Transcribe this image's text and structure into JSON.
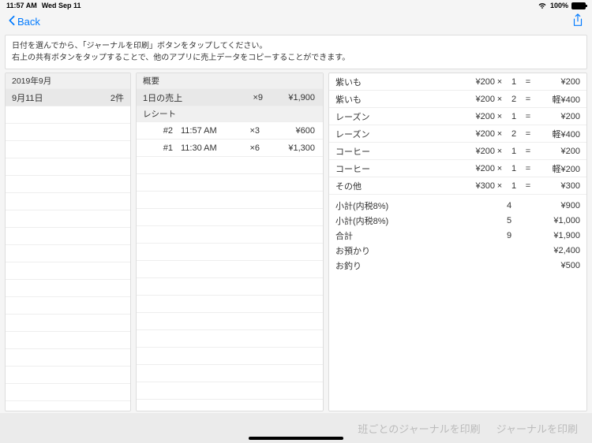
{
  "status": {
    "time": "11:57 AM",
    "date": "Wed Sep 11",
    "battery": "100%"
  },
  "nav": {
    "back": "Back"
  },
  "instructions": {
    "line1": "日付を選んでから、「ジャーナルを印刷」ボタンをタップしてください。",
    "line2": "右上の共有ボタンをタップすることで、他のアプリに売上データをコピーすることができます。"
  },
  "dates": {
    "header": "2019年9月",
    "items": [
      {
        "date": "9月11日",
        "count": "2件"
      }
    ]
  },
  "summary": {
    "header": "概要",
    "daily": {
      "label": "1日の売上",
      "qty": "×9",
      "amount": "¥1,900"
    },
    "receipts_header": "レシート",
    "receipts": [
      {
        "num": "#2",
        "time": "11:57 AM",
        "qty": "×3",
        "amount": "¥600"
      },
      {
        "num": "#1",
        "time": "11:30 AM",
        "qty": "×6",
        "amount": "¥1,300"
      }
    ]
  },
  "detail": {
    "items": [
      {
        "name": "紫いも",
        "price": "¥200",
        "times": "×",
        "qty": "1",
        "eq": "=",
        "total": "¥200"
      },
      {
        "name": "紫いも",
        "price": "¥200",
        "times": "×",
        "qty": "2",
        "eq": "=",
        "total": "軽¥400"
      },
      {
        "name": "レーズン",
        "price": "¥200",
        "times": "×",
        "qty": "1",
        "eq": "=",
        "total": "¥200"
      },
      {
        "name": "レーズン",
        "price": "¥200",
        "times": "×",
        "qty": "2",
        "eq": "=",
        "total": "軽¥400"
      },
      {
        "name": "コーヒー",
        "price": "¥200",
        "times": "×",
        "qty": "1",
        "eq": "=",
        "total": "¥200"
      },
      {
        "name": "コーヒー",
        "price": "¥200",
        "times": "×",
        "qty": "1",
        "eq": "=",
        "total": "軽¥200"
      },
      {
        "name": "その他",
        "price": "¥300",
        "times": "×",
        "qty": "1",
        "eq": "=",
        "total": "¥300"
      }
    ],
    "summary": [
      {
        "label": "小計(内税8%)",
        "qty": "4",
        "amount": "¥900"
      },
      {
        "label": "小計(内税8%)",
        "qty": "5",
        "amount": "¥1,000"
      },
      {
        "label": "合計",
        "qty": "9",
        "amount": "¥1,900"
      },
      {
        "label": "お預かり",
        "qty": "",
        "amount": "¥2,400"
      },
      {
        "label": "お釣り",
        "qty": "",
        "amount": "¥500"
      }
    ]
  },
  "bottom": {
    "print_by_group": "班ごとのジャーナルを印刷",
    "print_journal": "ジャーナルを印刷"
  }
}
